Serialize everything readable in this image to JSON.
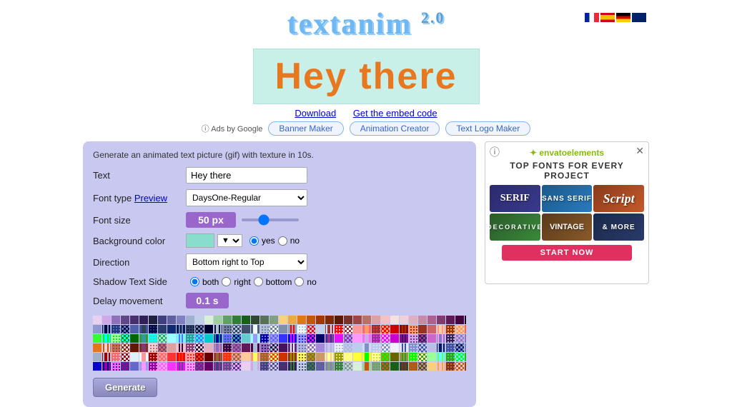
{
  "header": {
    "logo": "textanim",
    "version": "2.0",
    "tagline": "Generate an animated text picture (gif) with texture in 10s.",
    "download_label": "Download",
    "embed_label": "Get the embed code"
  },
  "nav": {
    "ads_label": "Ads by Google",
    "buttons": [
      {
        "label": "Banner Maker"
      },
      {
        "label": "Animation Creator"
      },
      {
        "label": "Text Logo Maker"
      }
    ]
  },
  "preview": {
    "text": "Hey there"
  },
  "form": {
    "text_label": "Text",
    "text_value": "Hey there",
    "font_type_label": "Font type",
    "font_preview_label": "Preview",
    "font_value": "DaysOne-Regular",
    "font_size_label": "Font size",
    "font_size_value": "50 px",
    "bg_color_label": "Background color",
    "bg_yes_label": "yes",
    "bg_no_label": "no",
    "direction_label": "Direction",
    "direction_value": "Bottom right to Top",
    "shadow_label": "Shadow Text Side",
    "shadow_both": "both",
    "shadow_right": "right",
    "shadow_bottom": "bottom",
    "shadow_no": "no",
    "delay_label": "Delay movement",
    "delay_value": "0.1 s",
    "generate_label": "Generate"
  },
  "ad": {
    "logo": "✦ envatoelements",
    "title": "TOP FONTS FOR EVERY PROJECT",
    "cells": [
      {
        "label": "SERIF",
        "style": "serif"
      },
      {
        "label": "SANS SERIF",
        "style": "sans"
      },
      {
        "label": "Script",
        "style": "script"
      },
      {
        "label": "DECORATIVE",
        "style": "deco"
      },
      {
        "label": "VINTAGE",
        "style": "vintage"
      },
      {
        "label": "& MORE",
        "style": "more"
      }
    ],
    "cta_label": "START NOW",
    "close_icon": "✕",
    "info_icon": "ⓘ"
  }
}
